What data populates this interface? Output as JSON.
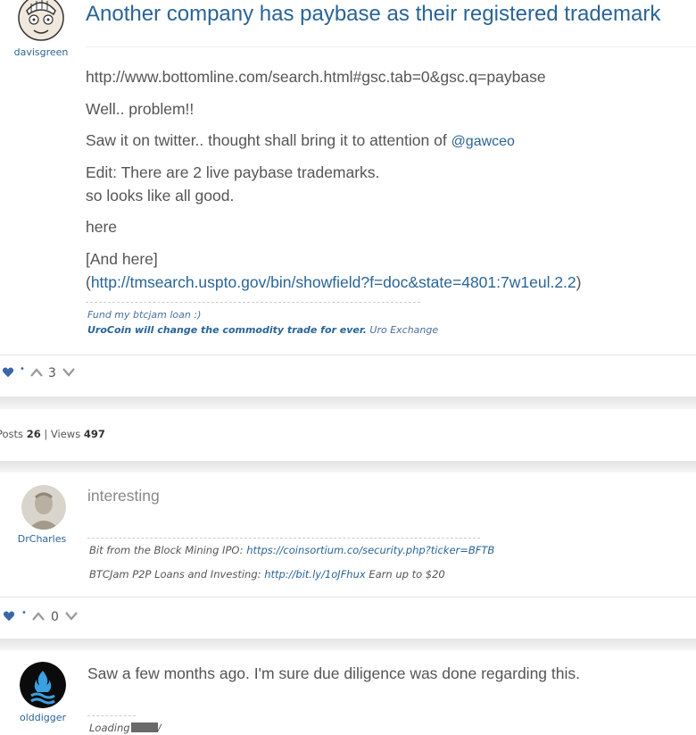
{
  "post1": {
    "username": "davisgreen",
    "title": "Another company has paybase as their registered trademark",
    "link": "http://www.bottomline.com/search.html#gsc.tab=0&gsc.q=paybase",
    "line_problem": "Well.. problem!!",
    "line_twitter": "Saw it on twitter.. thought shall bring it to attention of",
    "mention": "@gawceo",
    "edit_line1": "Edit: There are 2 live paybase trademarks.",
    "edit_line2": "so looks like all good.",
    "here_link": "here",
    "and_here": "[And here]",
    "uspto_open": "(",
    "uspto_link": "http://tmsearch.uspto.gov/bin/showfield?f=doc&state=4801:7w1eul.2.2",
    "uspto_close": ")",
    "sig_line1": "Fund my btcjam loan :)",
    "sig_line2_bold": "UroCoin will change the commodity trade for ever.",
    "sig_line2_rest": "Uro Exchange",
    "vote_count": "3"
  },
  "stats": {
    "posts_label": "Posts",
    "posts_value": "26",
    "separator": "|",
    "views_label": "Views",
    "views_value": "497"
  },
  "post2": {
    "username": "DrCharles",
    "body": "interesting",
    "sig1_prefix": "Bit from the Block Mining IPO:",
    "sig1_link": "https://coinsortium.co/security.php?ticker=BFTB",
    "sig2_prefix": "BTCJam P2P Loans and Investing:",
    "sig2_link": "http://bit.ly/1oJFhux",
    "sig2_suffix": "Earn up to $20",
    "vote_count": "0"
  },
  "post3": {
    "username": "olddigger",
    "body": "Saw a few months ago. I'm sure due diligence was done regarding this.",
    "sig_loading": "Loading",
    "sig_loading_tail": "/"
  },
  "colors": {
    "link": "#2a6496",
    "vote_blue": "#3a67a8",
    "text": "#555555"
  }
}
